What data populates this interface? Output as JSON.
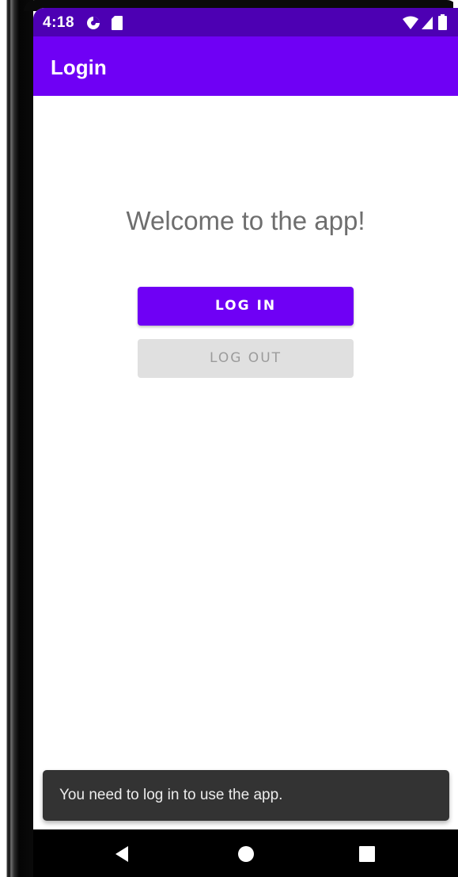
{
  "status_bar": {
    "time": "4:18",
    "icons_left": [
      "data-saver-icon",
      "sd-card-icon"
    ],
    "icons_right": [
      "wifi-icon",
      "signal-icon",
      "battery-icon"
    ],
    "color": "#4d00b3"
  },
  "app_bar": {
    "title": "Login",
    "color": "#6f00f5"
  },
  "main": {
    "welcome_text": "Welcome to the app!",
    "login_label": "LOG IN",
    "logout_label": "LOG OUT"
  },
  "snackbar": {
    "message": "You need to log in to use the app."
  },
  "nav_bar": {
    "icons": [
      "back-icon",
      "home-icon",
      "recents-icon"
    ]
  }
}
